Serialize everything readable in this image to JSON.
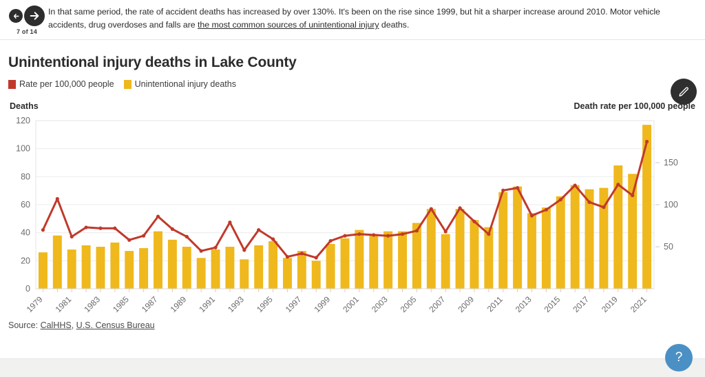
{
  "nav": {
    "back_icon": "arrow-left-icon",
    "forward_icon": "arrow-right-icon",
    "page_counter": "7 of 14"
  },
  "narrative": {
    "text_before_link": "In that same period, the rate of accident deaths has increased by over 130%. It's been on the rise since 1999, but hit a sharper increase around 2010. Motor vehicle accidents, drug overdoses and falls are ",
    "link_text": "the most common sources of unintentional injury",
    "text_after_link": " deaths."
  },
  "toolbar": {
    "edit_icon": "pencil-icon",
    "help_label": "?"
  },
  "source": {
    "prefix": "Source: ",
    "link1": "CalHHS",
    "separator": ", ",
    "link2": "U.S. Census Bureau"
  },
  "colors": {
    "bar": "#EFB81C",
    "line": "#C0392B",
    "grid": "#ebebeb",
    "axis_text": "#6b6b6b",
    "help_fab": "#4a90c4",
    "edit_fab": "#2f2f2f"
  },
  "chart_data": {
    "type": "bar",
    "title": "Unintentional injury deaths in Lake County",
    "xlabel": "",
    "ylabel": "Deaths",
    "y2label": "Death rate per 100,000 people",
    "ylim": [
      0,
      120
    ],
    "y2lim": [
      0,
      200
    ],
    "yticks": [
      0,
      20,
      40,
      60,
      80,
      100,
      120
    ],
    "y2ticks": [
      50,
      100,
      150
    ],
    "grid": true,
    "legend": [
      {
        "label": "Rate per 100,000 people",
        "color": "#C0392B",
        "type": "line"
      },
      {
        "label": "Unintentional injury deaths",
        "color": "#EFB81C",
        "type": "bar"
      }
    ],
    "categories": [
      "1979",
      "1980",
      "1981",
      "1982",
      "1983",
      "1984",
      "1985",
      "1986",
      "1987",
      "1988",
      "1989",
      "1990",
      "1991",
      "1992",
      "1993",
      "1994",
      "1995",
      "1996",
      "1997",
      "1998",
      "1999",
      "2000",
      "2001",
      "2002",
      "2003",
      "2004",
      "2005",
      "2006",
      "2007",
      "2008",
      "2009",
      "2010",
      "2011",
      "2012",
      "2013",
      "2014",
      "2015",
      "2016",
      "2017",
      "2018",
      "2019",
      "2020",
      "2021"
    ],
    "tick_labels": [
      "1979",
      "",
      "1981",
      "",
      "1983",
      "",
      "1985",
      "",
      "1987",
      "",
      "1989",
      "",
      "1991",
      "",
      "1993",
      "",
      "1995",
      "",
      "1997",
      "",
      "1999",
      "",
      "2001",
      "",
      "2003",
      "",
      "2005",
      "",
      "2007",
      "",
      "2009",
      "",
      "2011",
      "",
      "2013",
      "",
      "2015",
      "",
      "2017",
      "",
      "2019",
      "",
      "2021"
    ],
    "series": [
      {
        "name": "Unintentional injury deaths",
        "axis": "left",
        "type": "bar",
        "color": "#EFB81C",
        "values": [
          26,
          38,
          28,
          31,
          30,
          33,
          27,
          29,
          41,
          35,
          30,
          22,
          28,
          30,
          21,
          31,
          34,
          22,
          27,
          20,
          32,
          36,
          42,
          39,
          41,
          41,
          47,
          57,
          39,
          57,
          49,
          44,
          69,
          73,
          54,
          58,
          66,
          74,
          71,
          72,
          88,
          82,
          117
        ]
      },
      {
        "name": "Rate per 100,000 people",
        "axis": "right",
        "type": "line",
        "color": "#C0392B",
        "values": [
          70,
          107,
          62,
          73,
          72,
          72,
          58,
          63,
          86,
          71,
          62,
          45,
          49,
          79,
          46,
          70,
          59,
          38,
          42,
          37,
          57,
          63,
          65,
          64,
          63,
          65,
          69,
          95,
          68,
          96,
          80,
          65,
          117,
          120,
          87,
          94,
          106,
          123,
          103,
          97,
          124,
          111,
          175
        ]
      }
    ]
  }
}
